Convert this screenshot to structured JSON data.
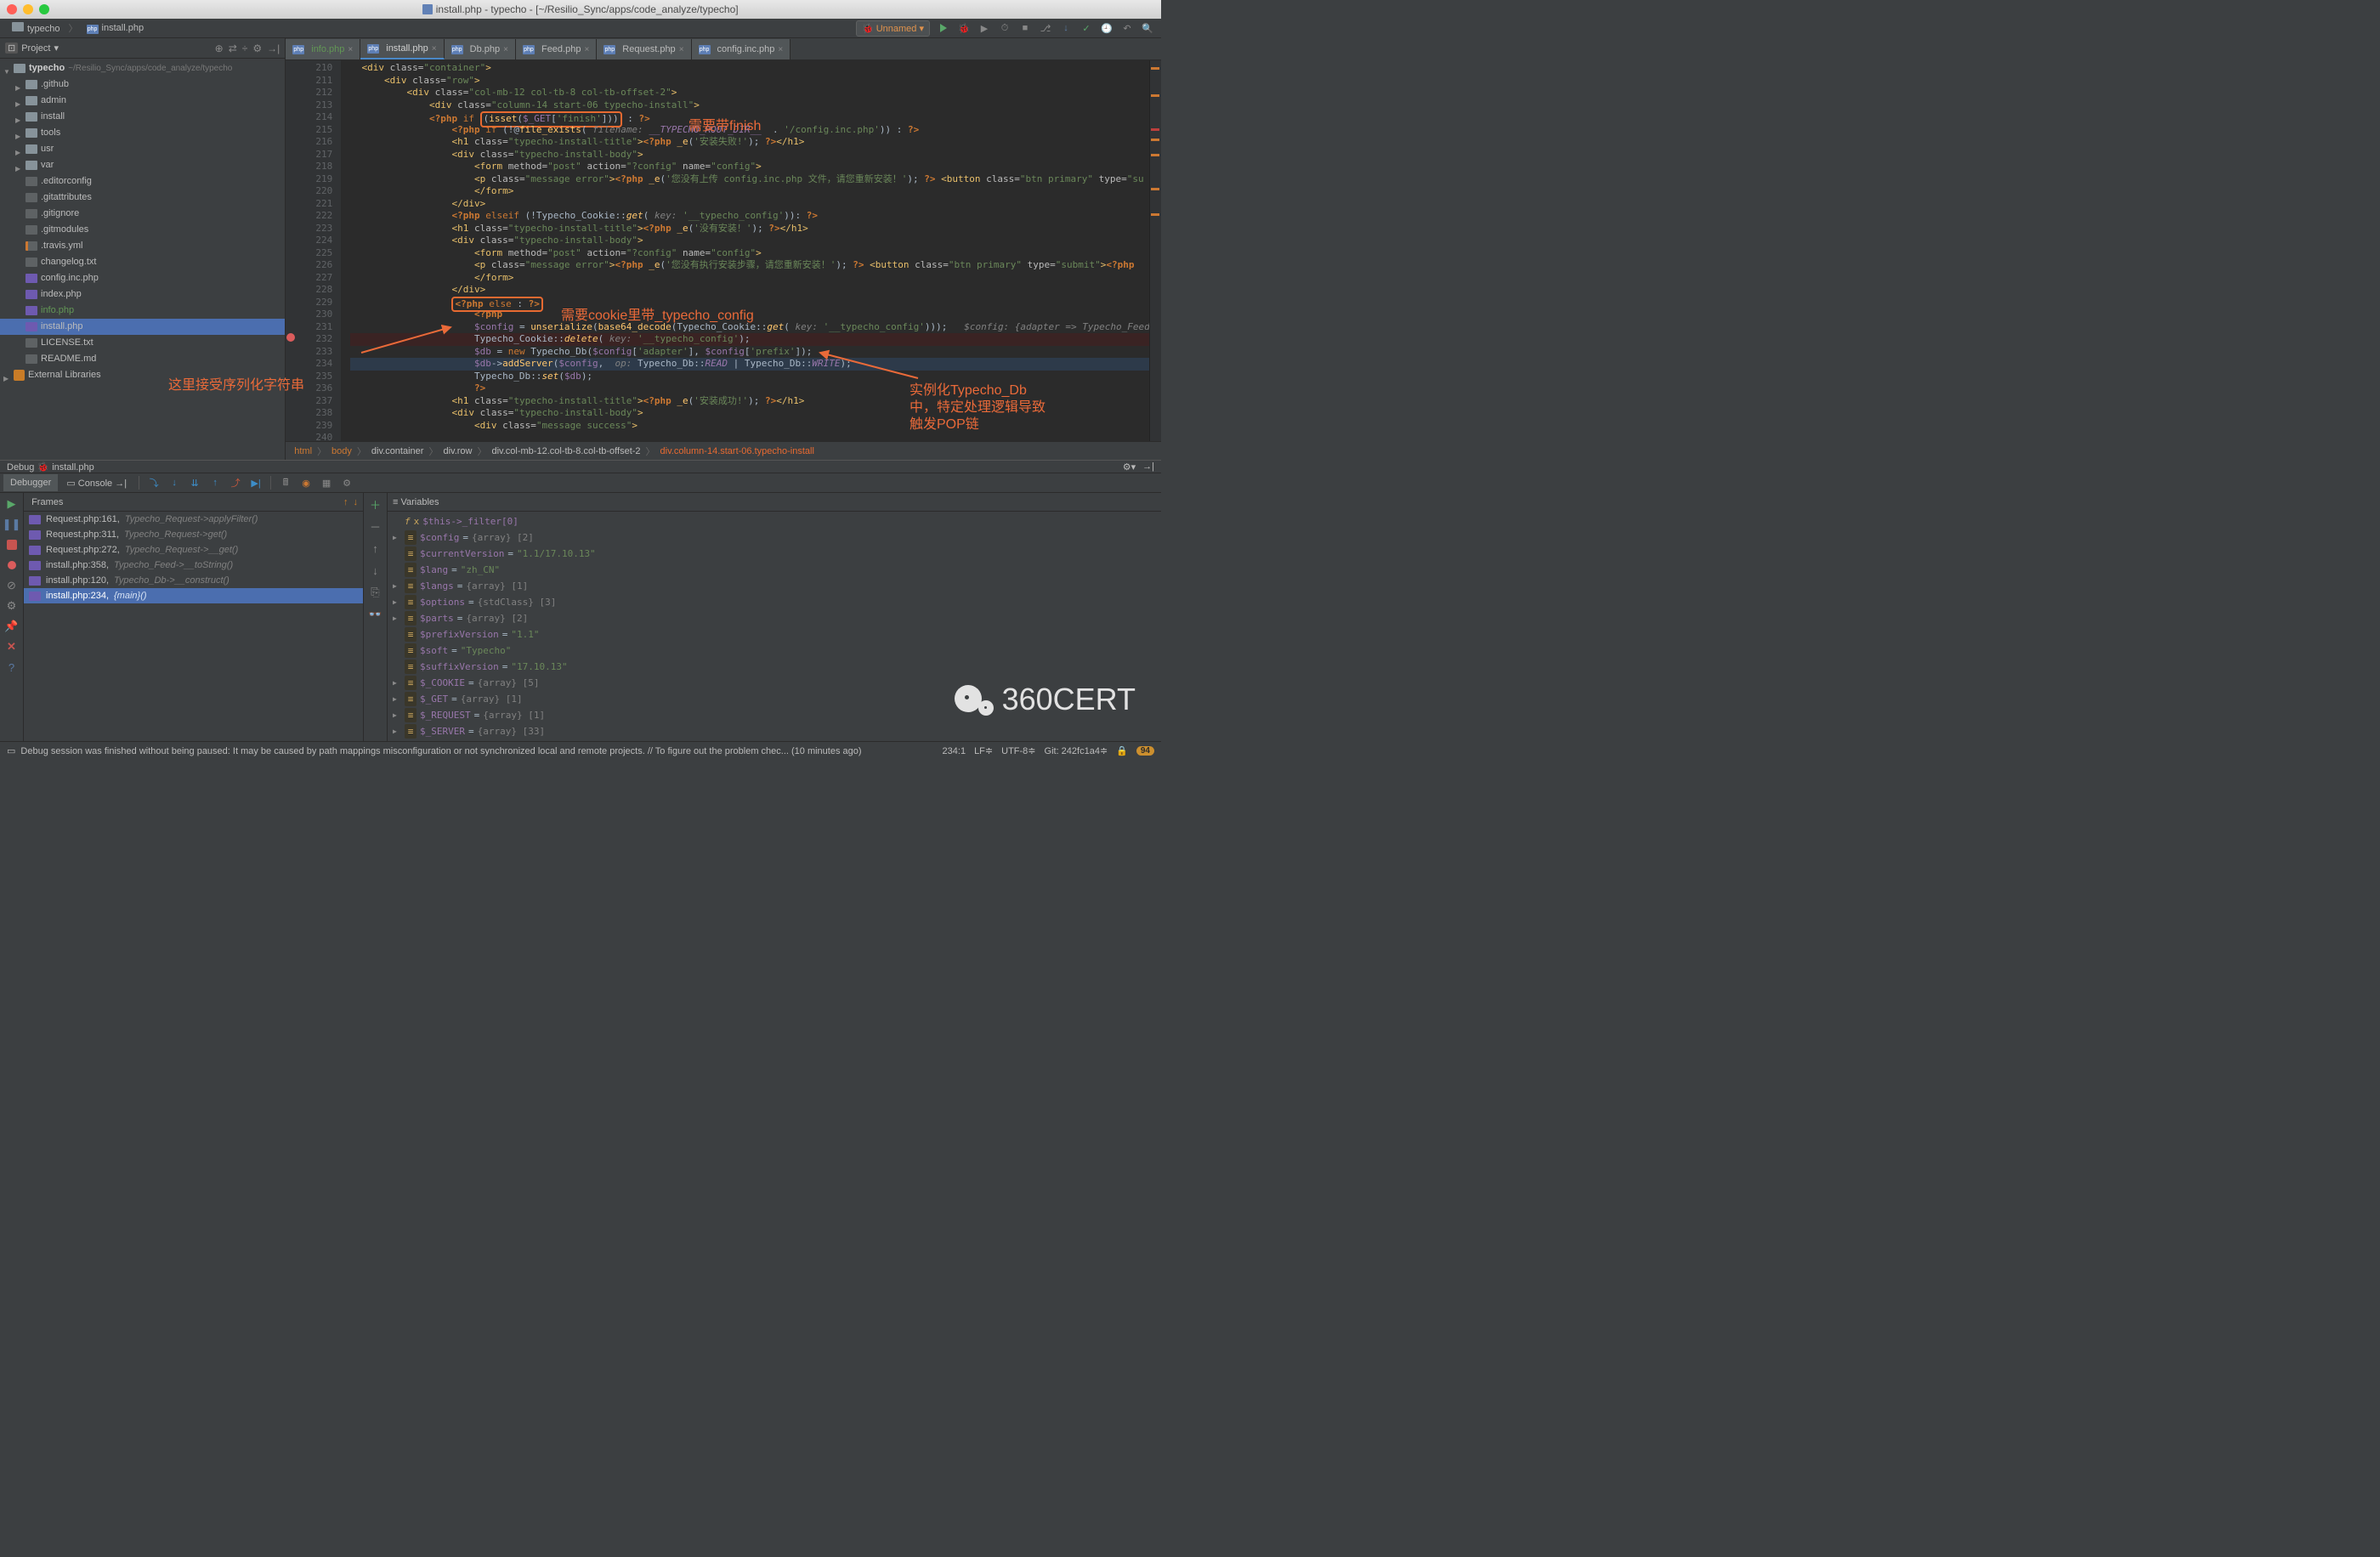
{
  "window": {
    "title": "install.php - typecho - [~/Resilio_Sync/apps/code_analyze/typecho]"
  },
  "navigation": {
    "crumbs": [
      "typecho",
      "install.php"
    ],
    "config_name": "Unnamed"
  },
  "project": {
    "title": "Project",
    "root": {
      "name": "typecho",
      "path": "~/Resilio_Sync/apps/code_analyze/typecho"
    },
    "tree": [
      {
        "depth": 1,
        "arrow": "closed",
        "icon": "folder",
        "label": ".github"
      },
      {
        "depth": 1,
        "arrow": "closed",
        "icon": "folder",
        "label": "admin"
      },
      {
        "depth": 1,
        "arrow": "closed",
        "icon": "folder",
        "label": "install"
      },
      {
        "depth": 1,
        "arrow": "closed",
        "icon": "folder",
        "label": "tools"
      },
      {
        "depth": 1,
        "arrow": "closed",
        "icon": "folder",
        "label": "usr"
      },
      {
        "depth": 1,
        "arrow": "closed",
        "icon": "folder",
        "label": "var"
      },
      {
        "depth": 1,
        "arrow": "none",
        "icon": "file-txt",
        "label": ".editorconfig"
      },
      {
        "depth": 1,
        "arrow": "none",
        "icon": "file-txt",
        "label": ".gitattributes"
      },
      {
        "depth": 1,
        "arrow": "none",
        "icon": "file-txt",
        "label": ".gitignore"
      },
      {
        "depth": 1,
        "arrow": "none",
        "icon": "file-txt",
        "label": ".gitmodules"
      },
      {
        "depth": 1,
        "arrow": "none",
        "icon": "file-yml",
        "label": ".travis.yml"
      },
      {
        "depth": 1,
        "arrow": "none",
        "icon": "file-txt",
        "label": "changelog.txt"
      },
      {
        "depth": 1,
        "arrow": "none",
        "icon": "file-php",
        "label": "config.inc.php"
      },
      {
        "depth": 1,
        "arrow": "none",
        "icon": "file-php",
        "label": "index.php"
      },
      {
        "depth": 1,
        "arrow": "none",
        "icon": "file-php",
        "label": "info.php",
        "green": true
      },
      {
        "depth": 1,
        "arrow": "none",
        "icon": "file-php",
        "label": "install.php",
        "selected": true
      },
      {
        "depth": 1,
        "arrow": "none",
        "icon": "file-txt",
        "label": "LICENSE.txt"
      },
      {
        "depth": 1,
        "arrow": "none",
        "icon": "file-md",
        "label": "README.md"
      }
    ],
    "external_libs": "External Libraries"
  },
  "tabs": [
    {
      "name": "info.php",
      "green": true
    },
    {
      "name": "install.php",
      "active": true
    },
    {
      "name": "Db.php"
    },
    {
      "name": "Feed.php"
    },
    {
      "name": "Request.php"
    },
    {
      "name": "config.inc.php"
    }
  ],
  "editor": {
    "first_line": 210,
    "last_line": 240
  },
  "breadcrumb": [
    "html",
    "body",
    "div.container",
    "div.row",
    "div.col-mb-12.col-tb-8.col-tb-offset-2",
    "div.column-14.start-06.typecho-install"
  ],
  "annotations": {
    "a1": "需要带finish",
    "a2": "需要cookie里带_typecho_config",
    "a3": "这里接受序列化字符串",
    "a4_l1": "实例化Typecho_Db",
    "a4_l2": "中，特定处理逻辑导致",
    "a4_l3": "触发POP链"
  },
  "debug": {
    "title": "install.php",
    "panel_prefix": "Debug",
    "tabs": {
      "debugger": "Debugger",
      "console": "Console"
    },
    "frames_title": "Frames",
    "vars_title": "Variables",
    "frames": [
      {
        "loc": "Request.php:161",
        "func": "Typecho_Request->applyFilter()"
      },
      {
        "loc": "Request.php:311",
        "func": "Typecho_Request->get()"
      },
      {
        "loc": "Request.php:272",
        "func": "Typecho_Request->__get()"
      },
      {
        "loc": "install.php:358",
        "func": "Typecho_Feed->__toString()"
      },
      {
        "loc": "install.php:120",
        "func": "Typecho_Db->__construct()"
      },
      {
        "loc": "install.php:234",
        "func": "{main}()",
        "selected": true
      }
    ],
    "variables": [
      {
        "expand": false,
        "fx": true,
        "name": "$this->_filter[0]",
        "value": ""
      },
      {
        "expand": true,
        "name": "$config",
        "type": "{array} [2]"
      },
      {
        "expand": false,
        "name": "$currentVersion",
        "str": "\"1.1/17.10.13\""
      },
      {
        "expand": false,
        "name": "$lang",
        "str": "\"zh_CN\""
      },
      {
        "expand": true,
        "name": "$langs",
        "type": "{array} [1]"
      },
      {
        "expand": true,
        "name": "$options",
        "type": "{stdClass} [3]"
      },
      {
        "expand": true,
        "name": "$parts",
        "type": "{array} [2]"
      },
      {
        "expand": false,
        "name": "$prefixVersion",
        "str": "\"1.1\""
      },
      {
        "expand": false,
        "name": "$soft",
        "str": "\"Typecho\""
      },
      {
        "expand": false,
        "name": "$suffixVersion",
        "str": "\"17.10.13\""
      },
      {
        "expand": true,
        "name": "$_COOKIE",
        "type": "{array} [5]"
      },
      {
        "expand": true,
        "name": "$_GET",
        "type": "{array} [1]"
      },
      {
        "expand": true,
        "name": "$_REQUEST",
        "type": "{array} [1]"
      },
      {
        "expand": true,
        "name": "$_SERVER",
        "type": "{array} [33]"
      }
    ]
  },
  "statusbar": {
    "message": "Debug session was finished without being paused: It may be caused by path mappings misconfiguration or not synchronized local and remote projects. // To figure out the problem chec... (10 minutes ago)",
    "pos": "234:1",
    "line_sep": "LF",
    "encoding": "UTF-8",
    "git": "Git: 242fc1a4",
    "badge": "94"
  },
  "watermark": "360CERT"
}
